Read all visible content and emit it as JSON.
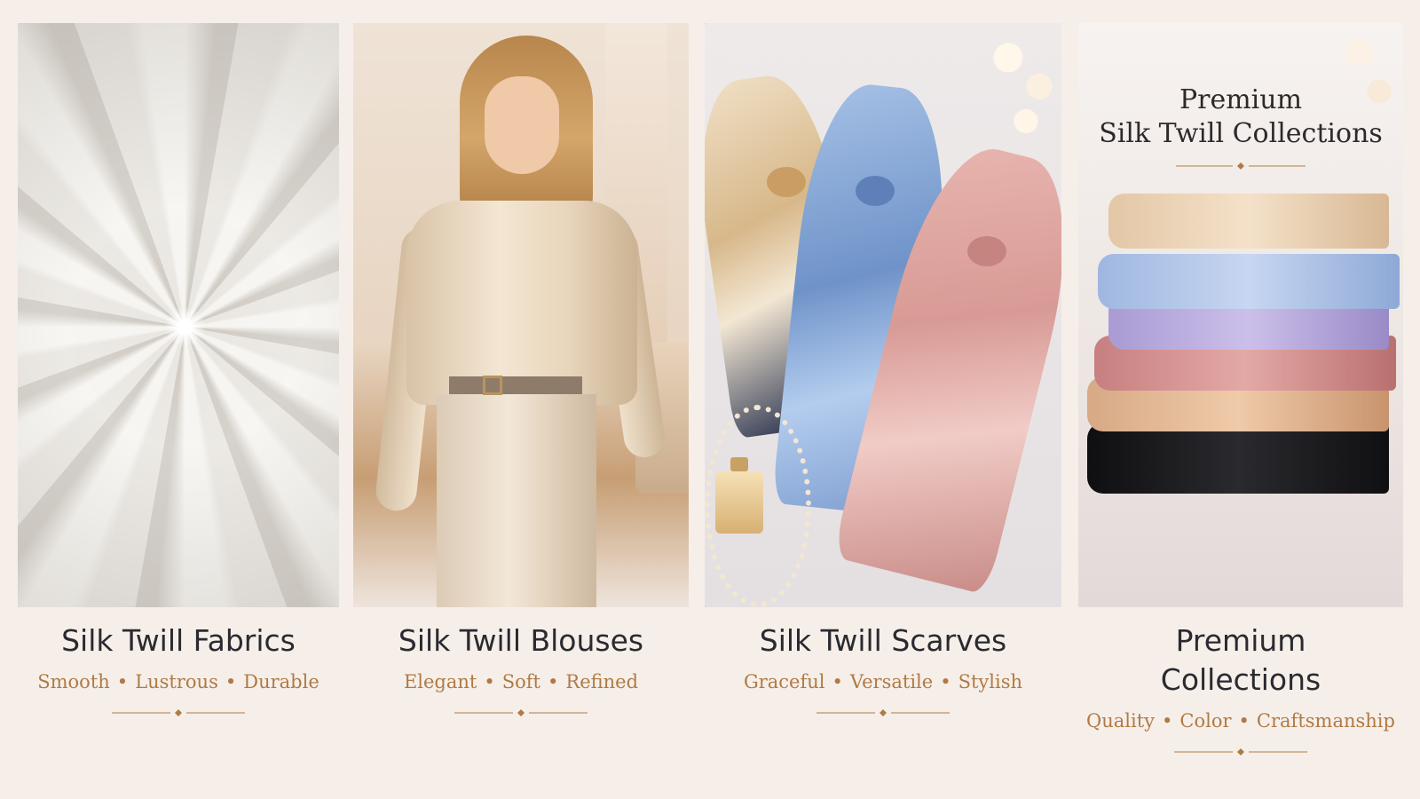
{
  "panels": [
    {
      "title": "Silk Twill Fabrics",
      "tags": [
        "Smooth",
        "Lustrous",
        "Durable"
      ]
    },
    {
      "title": "Silk Twill Blouses",
      "tags": [
        "Elegant",
        "Soft",
        "Refined"
      ]
    },
    {
      "title": "Silk Twill Scarves",
      "tags": [
        "Graceful",
        "Versatile",
        "Stylish"
      ]
    },
    {
      "title_line1": "Premium",
      "title_line2": "Collections",
      "tags": [
        "Quality",
        "Color",
        "Craftsmanship"
      ],
      "overlay_line1": "Premium",
      "overlay_line2": "Silk Twill Collections"
    }
  ],
  "separator": "•",
  "colors": {
    "background": "#f6efe9",
    "title_text": "#2a2a30",
    "accent_gold": "#b07a45"
  }
}
